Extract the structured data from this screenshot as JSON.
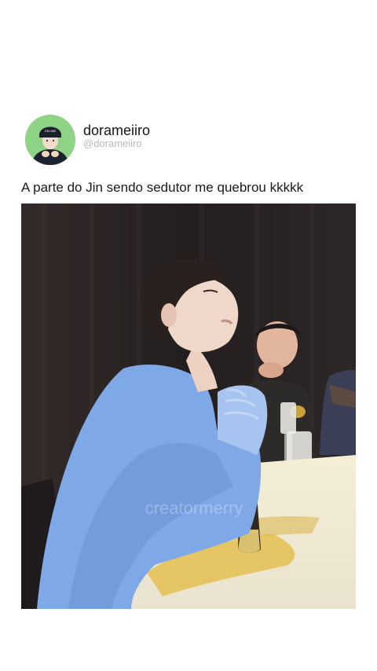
{
  "post": {
    "display_name": "dorameiiro",
    "handle": "@dorameiiro",
    "text": "A parte do Jin sendo sedutor me quebrou kkkkk",
    "media_watermark": "creatormerry"
  },
  "icons": {
    "avatar": "profile-photo",
    "media": "photo"
  },
  "colors": {
    "background": "#ffffff",
    "handle": "#b9b9b9",
    "avatar_bg": "#8fd486",
    "sweater": "#7ea9e6",
    "table": "#f1e9c8"
  }
}
